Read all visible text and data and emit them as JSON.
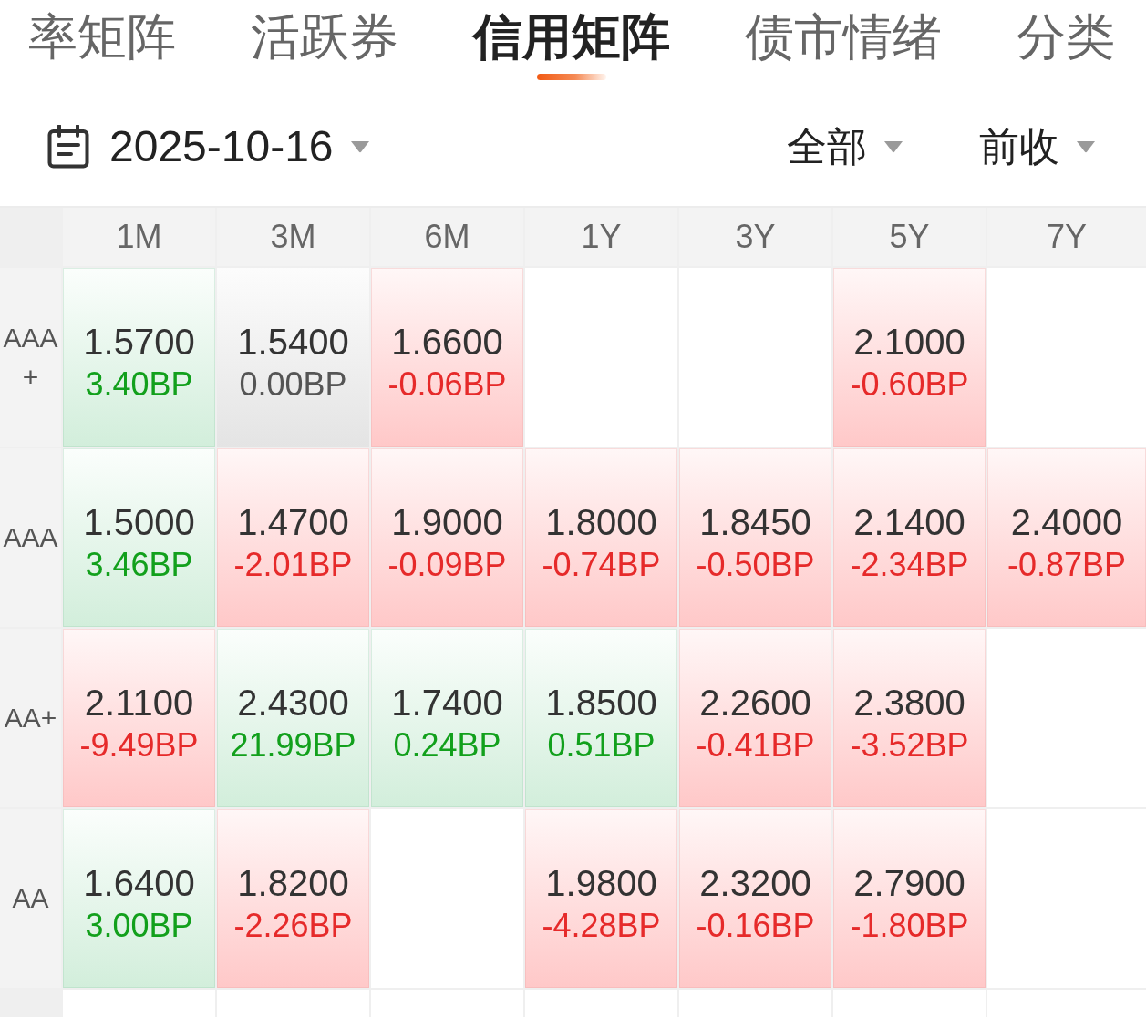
{
  "tabs": [
    {
      "label": "率矩阵",
      "selected": false
    },
    {
      "label": "活跃券",
      "selected": false
    },
    {
      "label": "信用矩阵",
      "selected": true
    },
    {
      "label": "债市情绪",
      "selected": false
    },
    {
      "label": "分类",
      "selected": false
    }
  ],
  "toolbar": {
    "date": "2025-10-16",
    "filters": [
      {
        "label": "全部"
      },
      {
        "label": "前收"
      }
    ]
  },
  "matrix": {
    "columns": [
      "1M",
      "3M",
      "6M",
      "1Y",
      "3Y",
      "5Y",
      "7Y"
    ],
    "rows": [
      {
        "rating": "AAA+",
        "cells": [
          {
            "yield": "1.5700",
            "change": "3.40BP",
            "kind": "up"
          },
          {
            "yield": "1.5400",
            "change": "0.00BP",
            "kind": "flat"
          },
          {
            "yield": "1.6600",
            "change": "-0.06BP",
            "kind": "down"
          },
          null,
          null,
          {
            "yield": "2.1000",
            "change": "-0.60BP",
            "kind": "down"
          },
          null
        ]
      },
      {
        "rating": "AAA",
        "cells": [
          {
            "yield": "1.5000",
            "change": "3.46BP",
            "kind": "up"
          },
          {
            "yield": "1.4700",
            "change": "-2.01BP",
            "kind": "down"
          },
          {
            "yield": "1.9000",
            "change": "-0.09BP",
            "kind": "down"
          },
          {
            "yield": "1.8000",
            "change": "-0.74BP",
            "kind": "down"
          },
          {
            "yield": "1.8450",
            "change": "-0.50BP",
            "kind": "down"
          },
          {
            "yield": "2.1400",
            "change": "-2.34BP",
            "kind": "down"
          },
          {
            "yield": "2.4000",
            "change": "-0.87BP",
            "kind": "down"
          }
        ]
      },
      {
        "rating": "AA+",
        "cells": [
          {
            "yield": "2.1100",
            "change": "-9.49BP",
            "kind": "down"
          },
          {
            "yield": "2.4300",
            "change": "21.99BP",
            "kind": "up"
          },
          {
            "yield": "1.7400",
            "change": "0.24BP",
            "kind": "up"
          },
          {
            "yield": "1.8500",
            "change": "0.51BP",
            "kind": "up"
          },
          {
            "yield": "2.2600",
            "change": "-0.41BP",
            "kind": "down"
          },
          {
            "yield": "2.3800",
            "change": "-3.52BP",
            "kind": "down"
          },
          null
        ]
      },
      {
        "rating": "AA",
        "cells": [
          {
            "yield": "1.6400",
            "change": "3.00BP",
            "kind": "up"
          },
          {
            "yield": "1.8200",
            "change": "-2.26BP",
            "kind": "down"
          },
          null,
          {
            "yield": "1.9800",
            "change": "-4.28BP",
            "kind": "down"
          },
          {
            "yield": "2.3200",
            "change": "-0.16BP",
            "kind": "down"
          },
          {
            "yield": "2.7900",
            "change": "-1.80BP",
            "kind": "down"
          },
          null
        ]
      }
    ]
  }
}
